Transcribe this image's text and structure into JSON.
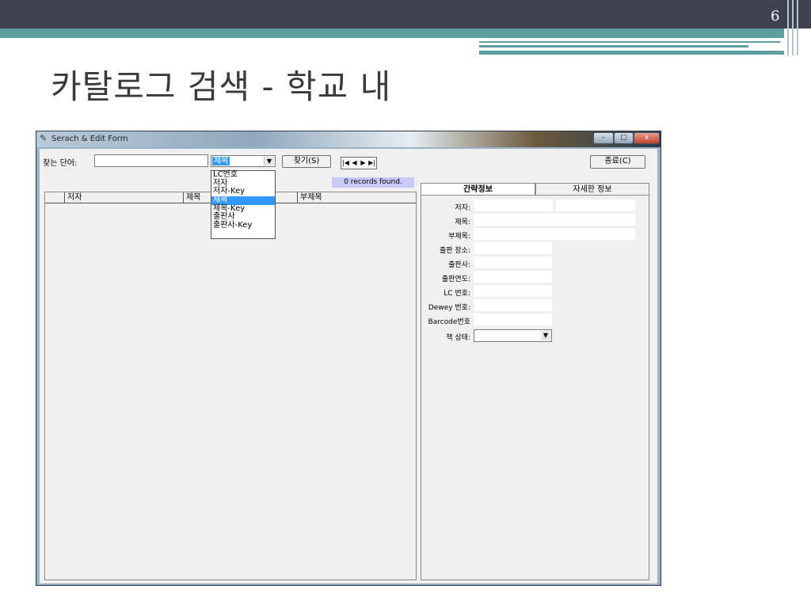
{
  "slide": {
    "page_number": "6",
    "title": "카탈로그 검색 - 학교 내"
  },
  "window": {
    "title": "Serach & Edit Form",
    "minimize": "–",
    "maximize": "□",
    "close": "x"
  },
  "search": {
    "label": "찾는 단어:",
    "field_value": "",
    "field_selected": "제목",
    "find_button": "찾기(S)",
    "close_button": "종료(C)",
    "nav": [
      "|◀",
      "◀",
      "▶",
      "▶|"
    ],
    "records_status": "0 records found."
  },
  "dropdown": {
    "options": [
      "LC번호",
      "저자",
      "저자-Key",
      "제목",
      "제목-Key",
      "출판사",
      "출판사-Key"
    ],
    "selected_index": 3
  },
  "list": {
    "columns": [
      "저자",
      "제목",
      "부제목"
    ]
  },
  "tabs": {
    "active": "간략정보",
    "inactive": "자세한 정보"
  },
  "detail_fields": {
    "author": "저자:",
    "title": "제목:",
    "subtitle": "부제목:",
    "pub_place": "출판 장소:",
    "publisher": "출판사:",
    "pub_year": "출판연도:",
    "lc_number": "LC 번호:",
    "dewey_number": "Dewey 번호:",
    "barcode_number": "Barcode번호",
    "book_status": "책 상태:"
  },
  "colors": {
    "selection": "#3399ff",
    "records_bg": "#c9c9f7",
    "slide_bar": "#3f4150",
    "slide_band": "#5e9ea0"
  }
}
